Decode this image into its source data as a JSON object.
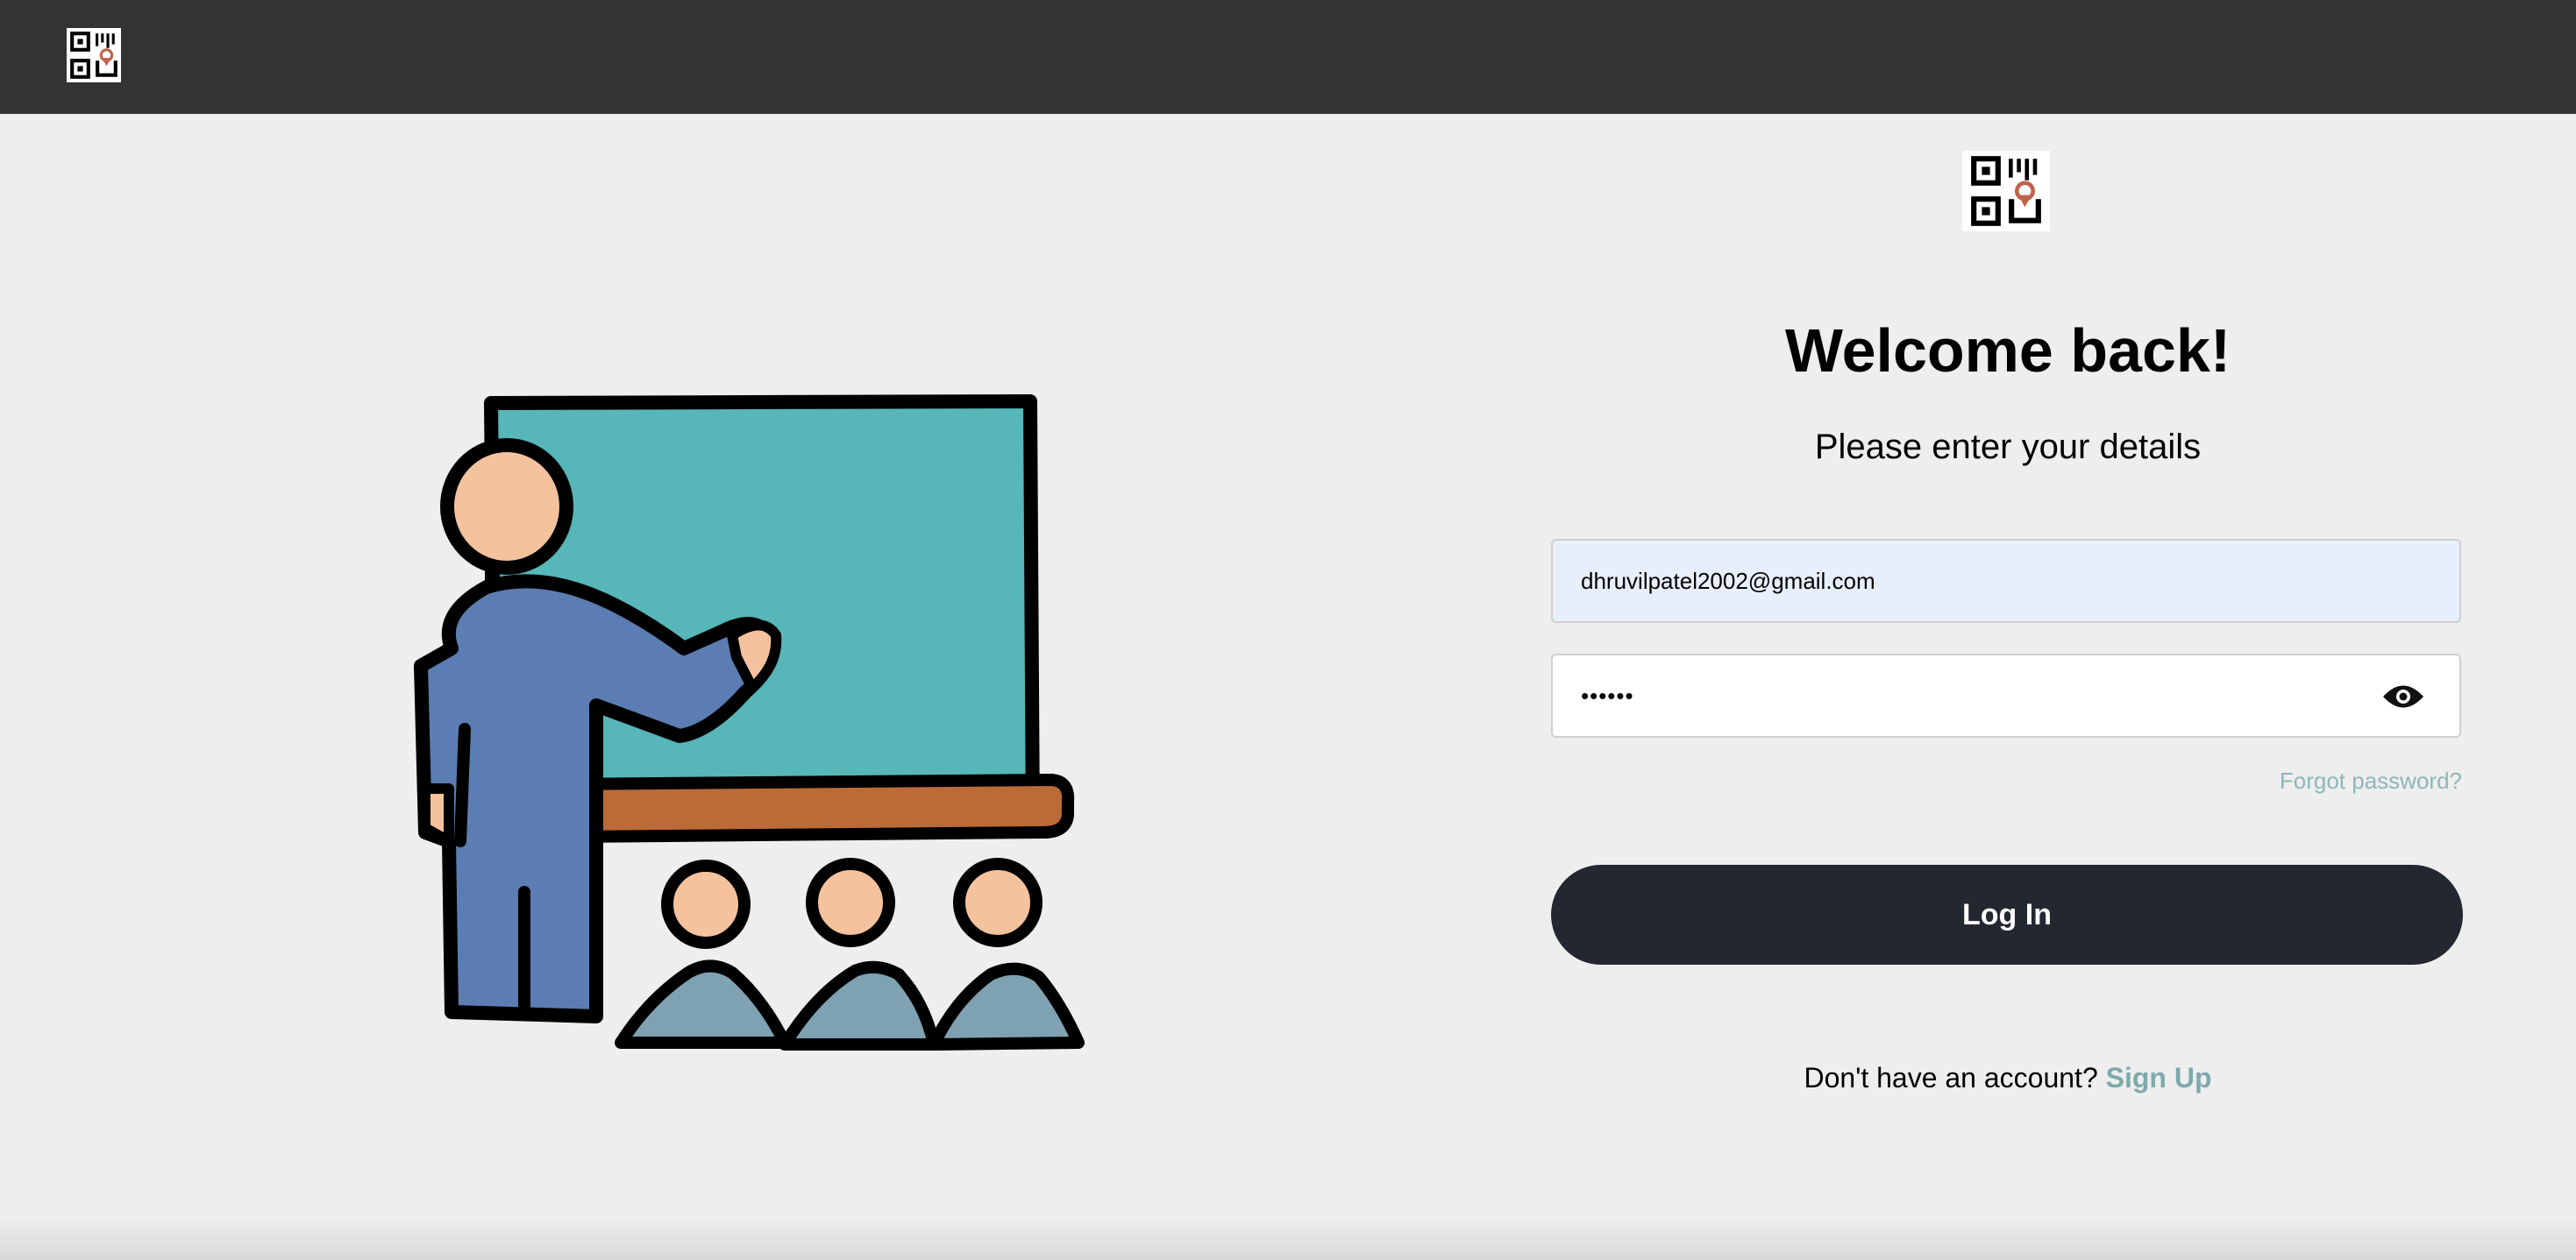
{
  "header": {
    "logo_icon": "qr-location-logo-icon"
  },
  "illustration": {
    "icon": "teacher-classroom-illustration"
  },
  "login": {
    "logo_icon": "qr-location-logo-icon",
    "title": "Welcome back!",
    "subtitle": "Please enter your details",
    "email_value": "dhruvilpatel2002@gmail.com",
    "password_value": "••••••",
    "password_toggle_icon": "eye-icon",
    "forgot_label": "Forgot password?",
    "login_label": "Log In",
    "signup_prompt": "Don't have an account?",
    "signup_label": "Sign Up"
  },
  "colors": {
    "topbar": "#333333",
    "background": "#eeeeee",
    "email_field_bg": "#e8effc",
    "button_bg": "#232730",
    "link": "#7fa9ab",
    "forgot_link": "#8fb5b7",
    "logo_accent": "#c0634b"
  }
}
